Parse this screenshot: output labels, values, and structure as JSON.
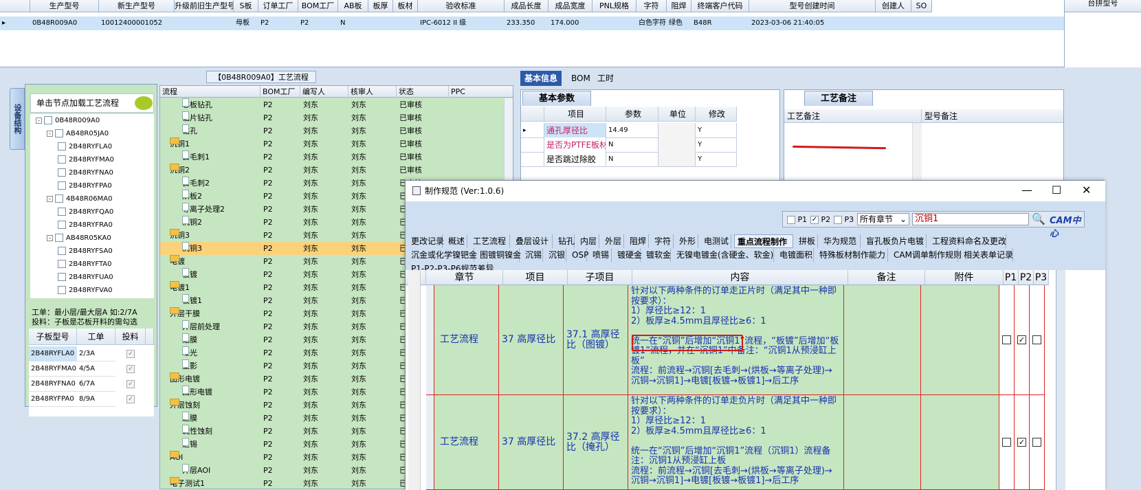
{
  "top_grid": {
    "headers": [
      "生产型号",
      "新生产型号",
      "升级前旧生产型号",
      "S板",
      "订单工厂",
      "BOM工厂",
      "AB板",
      "板厚",
      "板材",
      "验收标准",
      "成品长度",
      "成品宽度",
      "PNL规格",
      "字符",
      "阻焊",
      "终端客户代码",
      "型号创建时间",
      "创建人",
      "SO"
    ],
    "row": {
      "col1": "0B48R009A0",
      "col2": "10012400001052",
      "col4": "母板",
      "col5": "P2",
      "col6": "P2",
      "col7": "N",
      "col10": "IPC-6012 II 级",
      "col11": "233.350",
      "col12": "174.000",
      "col14": "白色字符",
      "col15": "绿色",
      "col16": "B48R",
      "col17": "2023-03-06 21:40:05"
    },
    "right_header": "台拼型号"
  },
  "left": {
    "side_tab": "设备结构",
    "load_button": "单击节点加载工艺流程",
    "tree": [
      {
        "label": "0B48R009A0",
        "level": 0,
        "expander": "-"
      },
      {
        "label": "AB48R05JA0",
        "level": 1,
        "expander": "-"
      },
      {
        "label": "2B48RYFLA0",
        "level": 2
      },
      {
        "label": "2B48RYFMA0",
        "level": 2
      },
      {
        "label": "2B48RYFNA0",
        "level": 2
      },
      {
        "label": "2B48RYFPA0",
        "level": 2
      },
      {
        "label": "4B48R06MA0",
        "level": 1,
        "expander": "-"
      },
      {
        "label": "2B48RYFQA0",
        "level": 2
      },
      {
        "label": "2B48RYFRA0",
        "level": 2
      },
      {
        "label": "AB48R05KA0",
        "level": 1,
        "expander": "-"
      },
      {
        "label": "2B48RYFSA0",
        "level": 2
      },
      {
        "label": "2B48RYFTA0",
        "level": 2
      },
      {
        "label": "2B48RYFUA0",
        "level": 2
      },
      {
        "label": "2B48RYFVA0",
        "level": 2
      }
    ],
    "note_line1": "工单：最小层/最大层A 如:2/7A",
    "note_line2": "投料：子板是芯板开料的需勾选",
    "sub_grid": {
      "headers": [
        "子板型号",
        "工单",
        "投料"
      ],
      "rows": [
        {
          "model": "2B48RYFLA0",
          "order": "2/3A",
          "check": "✓"
        },
        {
          "model": "2B48RYFMA0",
          "order": "4/5A",
          "check": "✓"
        },
        {
          "model": "2B48RYFNA0",
          "order": "6/7A",
          "check": "✓"
        },
        {
          "model": "2B48RYFPA0",
          "order": "8/9A",
          "check": "✓"
        }
      ]
    }
  },
  "process": {
    "title": "【0B48R009A0】工艺流程",
    "headers": [
      "流程",
      "BOM工厂",
      "编写人",
      "核审人",
      "状态",
      "PPC"
    ],
    "rows": [
      {
        "name": "芯板钻孔",
        "folder": false,
        "indent": 2,
        "bom": "P2",
        "writer": "刘东",
        "reviewer": "刘东",
        "status": "已审核"
      },
      {
        "name": "铝片钻孔",
        "folder": false,
        "indent": 2,
        "bom": "P2",
        "writer": "刘东",
        "reviewer": "刘东",
        "status": "已审核"
      },
      {
        "name": "钻孔",
        "folder": false,
        "indent": 2,
        "bom": "P2",
        "writer": "刘东",
        "reviewer": "刘东",
        "status": "已审核"
      },
      {
        "name": "沉铜1",
        "folder": true,
        "indent": 1,
        "bom": "P2",
        "writer": "刘东",
        "reviewer": "刘东",
        "status": "已审核"
      },
      {
        "name": "去毛刺1",
        "folder": false,
        "indent": 2,
        "bom": "P2",
        "writer": "刘东",
        "reviewer": "刘东",
        "status": "已审核"
      },
      {
        "name": "沉铜2",
        "folder": true,
        "indent": 1,
        "bom": "P2",
        "writer": "刘东",
        "reviewer": "刘东",
        "status": "已审核"
      },
      {
        "name": "去毛刺2",
        "folder": false,
        "indent": 2,
        "bom": "P2",
        "writer": "刘东",
        "reviewer": "刘东",
        "status": "已审核"
      },
      {
        "name": "烘板2",
        "folder": false,
        "indent": 2,
        "bom": "P2",
        "writer": "刘东",
        "reviewer": "刘东",
        "status": "已审核"
      },
      {
        "name": "等离子处理2",
        "folder": false,
        "indent": 2,
        "bom": "P2",
        "writer": "刘东",
        "reviewer": "刘东",
        "status": "已审核"
      },
      {
        "name": "沉铜2",
        "folder": false,
        "indent": 2,
        "bom": "P2",
        "writer": "刘东",
        "reviewer": "刘东",
        "status": "已审核"
      },
      {
        "name": "沉铜3",
        "folder": true,
        "indent": 1,
        "bom": "P2",
        "writer": "刘东",
        "reviewer": "刘东",
        "status": "已审核"
      },
      {
        "name": "沉铜3",
        "folder": false,
        "indent": 2,
        "bom": "P2",
        "writer": "刘东",
        "reviewer": "刘东",
        "status": "已审核",
        "selected": true
      },
      {
        "name": "电镀",
        "folder": true,
        "indent": 1,
        "bom": "P2",
        "writer": "刘东",
        "reviewer": "刘东",
        "status": "已审核"
      },
      {
        "name": "板镀",
        "folder": false,
        "indent": 2,
        "bom": "P2",
        "writer": "刘东",
        "reviewer": "刘东",
        "status": "已审核"
      },
      {
        "name": "电镀1",
        "folder": true,
        "indent": 1,
        "bom": "P2",
        "writer": "刘东",
        "reviewer": "刘东",
        "status": "已审核"
      },
      {
        "name": "板镀1",
        "folder": false,
        "indent": 2,
        "bom": "P2",
        "writer": "刘东",
        "reviewer": "刘东",
        "status": "已审核"
      },
      {
        "name": "外层干膜",
        "folder": true,
        "indent": 1,
        "bom": "P2",
        "writer": "刘东",
        "reviewer": "刘东",
        "status": "已审核"
      },
      {
        "name": "外层前处理",
        "folder": false,
        "indent": 2,
        "bom": "P2",
        "writer": "刘东",
        "reviewer": "刘东",
        "status": "已审核"
      },
      {
        "name": "贴膜",
        "folder": false,
        "indent": 2,
        "bom": "P2",
        "writer": "刘东",
        "reviewer": "刘东",
        "status": "已审核"
      },
      {
        "name": "曝光",
        "folder": false,
        "indent": 2,
        "bom": "P2",
        "writer": "刘东",
        "reviewer": "刘东",
        "status": "已审核"
      },
      {
        "name": "显影",
        "folder": false,
        "indent": 2,
        "bom": "P2",
        "writer": "刘东",
        "reviewer": "刘东",
        "status": "已审核"
      },
      {
        "name": "图形电镀",
        "folder": true,
        "indent": 1,
        "bom": "P2",
        "writer": "刘东",
        "reviewer": "刘东",
        "status": "已审核"
      },
      {
        "name": "图形电镀",
        "folder": false,
        "indent": 2,
        "bom": "P2",
        "writer": "刘东",
        "reviewer": "刘东",
        "status": "已审核"
      },
      {
        "name": "外层蚀刻",
        "folder": true,
        "indent": 1,
        "bom": "P2",
        "writer": "刘东",
        "reviewer": "刘东",
        "status": "已审核"
      },
      {
        "name": "退膜",
        "folder": false,
        "indent": 2,
        "bom": "P2",
        "writer": "刘东",
        "reviewer": "刘东",
        "status": "已审核"
      },
      {
        "name": "碱性蚀刻",
        "folder": false,
        "indent": 2,
        "bom": "P2",
        "writer": "刘东",
        "reviewer": "刘东",
        "status": "已审核"
      },
      {
        "name": "退锡",
        "folder": false,
        "indent": 2,
        "bom": "P2",
        "writer": "刘东",
        "reviewer": "刘东",
        "status": "已审核"
      },
      {
        "name": "AOI",
        "folder": true,
        "indent": 1,
        "bom": "P2",
        "writer": "刘东",
        "reviewer": "刘东",
        "status": "已审核"
      },
      {
        "name": "外层AOI",
        "folder": false,
        "indent": 2,
        "bom": "P2",
        "writer": "刘东",
        "reviewer": "刘东",
        "status": "已审核"
      },
      {
        "name": "电子测试1",
        "folder": true,
        "indent": 1,
        "bom": "P2",
        "writer": "刘东",
        "reviewer": "刘东",
        "status": "已审核"
      }
    ]
  },
  "right_tabs": [
    "基本信息",
    "BOM",
    "工时"
  ],
  "basic": {
    "tab": "基本参数",
    "headers": [
      "项目",
      "参数",
      "单位",
      "修改"
    ],
    "rows": [
      {
        "item": "通孔厚径比",
        "value": "14.49",
        "unit": "",
        "modify": "Y",
        "color": "#c0206a"
      },
      {
        "item": "是否为PTFE板材",
        "value": "N",
        "unit": "",
        "modify": "Y",
        "color": "#c0206a"
      },
      {
        "item": "是否跳过除胶",
        "value": "N",
        "unit": "",
        "modify": "Y",
        "color": "#000"
      }
    ]
  },
  "notes": {
    "tab": "工艺备注",
    "col1": "工艺备注",
    "col2": "型号备注"
  },
  "dialog": {
    "title": "制作规范 (Ver:1.0.6)",
    "filter": {
      "p1": "P1",
      "p2": "P2",
      "p3": "P3",
      "p2_checked": "✓",
      "chapter": "所有章节",
      "search": "沉铜1"
    },
    "logo": "CAM中心",
    "tabs_row1": [
      "更改记录",
      "概述",
      "工艺流程",
      "叠层设计",
      "钻孔",
      "内层",
      "外层",
      "阻焊",
      "字符",
      "外形",
      "电测试",
      "重点流程制作",
      "拼板",
      "华为规范",
      "盲孔板负片电镀",
      "工程资料命名及更改"
    ],
    "tabs_row2": [
      "沉金或化学镍钯金",
      "图镀铜镍金",
      "沉锡",
      "沉银",
      "OSP",
      "喷锡",
      "镀硬金",
      "镀软金",
      "无镍电镀金(含硬金、软金)",
      "电镀面积",
      "特殊板材制作能力",
      "CAM调单制作规则",
      "相关表单记录"
    ],
    "tabs_row3": [
      "P1-P2-P3-P6规范差异"
    ],
    "active_tab": "重点流程制作",
    "grid_headers": [
      "章节",
      "项目",
      "子项目",
      "内容",
      "备注",
      "附件",
      "P1",
      "P2",
      "P3"
    ],
    "rows": [
      {
        "chapter": "工艺流程",
        "item": "37 高厚径比",
        "sub": "37.1 高厚径比（图镀）",
        "content": "针对以下两种条件的订单走正片时（满足其中一种即按要求）：\n1）厚径比≥12：1\n2）板厚≥4.5mm且厚径比≥6：1\n\n统一在“沉铜”后增加“沉铜1”流程，“板镀”后增加“板镀1”流程，并在“沉铜1”中备注：“沉铜1从预浸缸上板”\n流程：前流程→沉铜[去毛刺→(烘板→等离子处理)→沉铜→沉铜1]→电镀[板镀→板镀1]→后工序",
        "p1": "",
        "p2": "✓",
        "p3": ""
      },
      {
        "chapter": "工艺流程",
        "item": "37 高厚径比",
        "sub": "37.2 高厚径比（掩孔）",
        "content": "针对以下两种条件的订单走负片时（满足其中一种即按要求）：\n1）厚径比≥12：1\n2）板厚≥4.5mm且厚径比≥6：1\n\n统一在“沉铜”后增加“沉铜1”流程（沉铜1）流程备注：沉铜1从预浸缸上板\n流程：前流程→沉铜[去毛刺→(烘板→等离子处理)→沉铜→沉铜1]→电镀[板镀→板镀1]→后工序",
        "p1": "",
        "p2": "✓",
        "p3": ""
      }
    ]
  }
}
